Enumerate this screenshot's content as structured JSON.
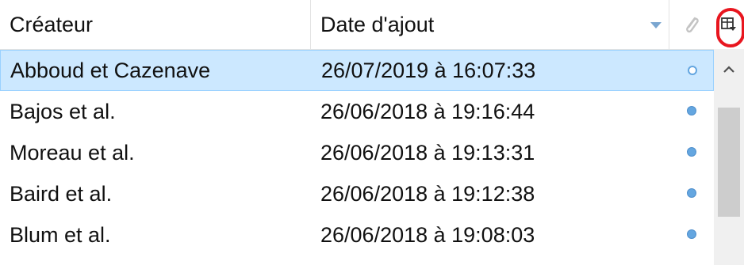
{
  "header": {
    "creator_label": "Créateur",
    "date_label": "Date d'ajout",
    "attachment_icon": "paperclip-icon",
    "column_picker_icon": "column-picker-icon",
    "sort_icon": "sort-descending-icon"
  },
  "rows": [
    {
      "creator": "Abboud et Cazenave",
      "date": "26/07/2019 à 16:07:33",
      "selected": true,
      "attachment": "hollow-dot"
    },
    {
      "creator": "Bajos et al.",
      "date": "26/06/2018 à 19:16:44",
      "selected": false,
      "attachment": "filled-dot"
    },
    {
      "creator": "Moreau et al.",
      "date": "26/06/2018 à 19:13:31",
      "selected": false,
      "attachment": "filled-dot"
    },
    {
      "creator": "Baird et al.",
      "date": "26/06/2018 à 19:12:38",
      "selected": false,
      "attachment": "filled-dot"
    },
    {
      "creator": "Blum et al.",
      "date": "26/06/2018 à 19:08:03",
      "selected": false,
      "attachment": "filled-dot"
    }
  ],
  "colors": {
    "selection_bg": "#cce8ff",
    "selection_border": "#99d1ff",
    "dot": "#64a6e0",
    "highlight_ring": "#e8161f"
  }
}
